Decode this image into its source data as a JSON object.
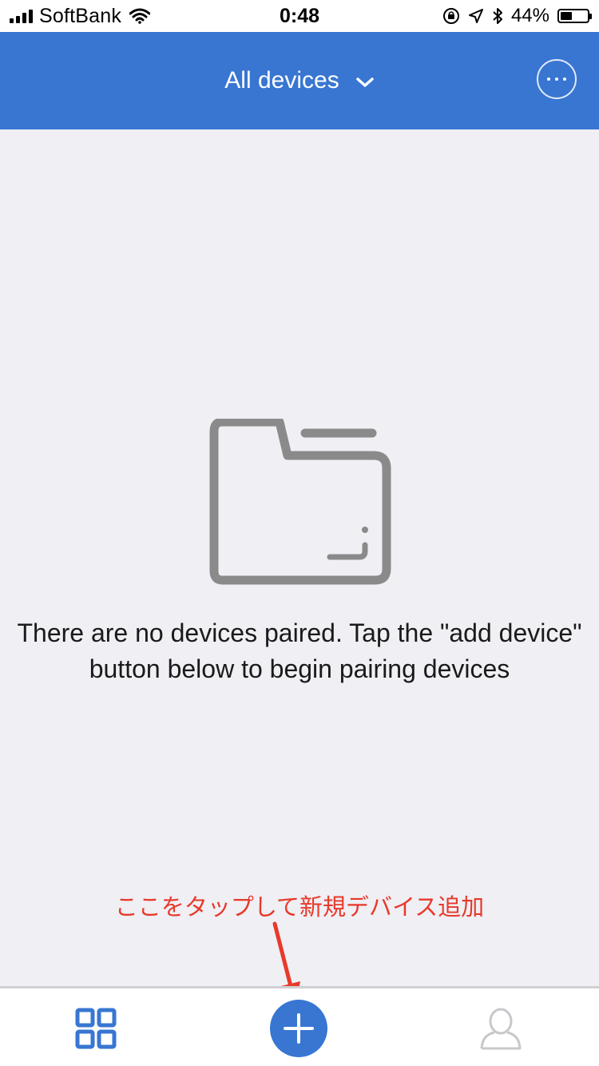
{
  "status_bar": {
    "carrier": "SoftBank",
    "time": "0:48",
    "battery_percent": "44%",
    "battery_level": 0.44,
    "icons": [
      "signal-icon",
      "wifi-icon",
      "orientation-lock-icon",
      "location-icon",
      "bluetooth-icon",
      "battery-icon"
    ]
  },
  "header": {
    "title": "All devices",
    "dropdown_icon": "chevron-down-icon",
    "more_icon": "more-icon"
  },
  "empty_state": {
    "icon": "empty-folder-icon",
    "message": "There are no devices paired. Tap the \"add device\" button below to begin pairing devices"
  },
  "annotation": {
    "text": "ここをタップして新規デバイス追加",
    "color": "#e8392a"
  },
  "tab_bar": {
    "items": [
      {
        "icon": "grid-icon"
      },
      {
        "icon": "plus-icon"
      },
      {
        "icon": "user-icon"
      }
    ]
  },
  "colors": {
    "accent": "#3876d2",
    "background": "#efeff4",
    "icon_gray": "#8a8a8a"
  }
}
